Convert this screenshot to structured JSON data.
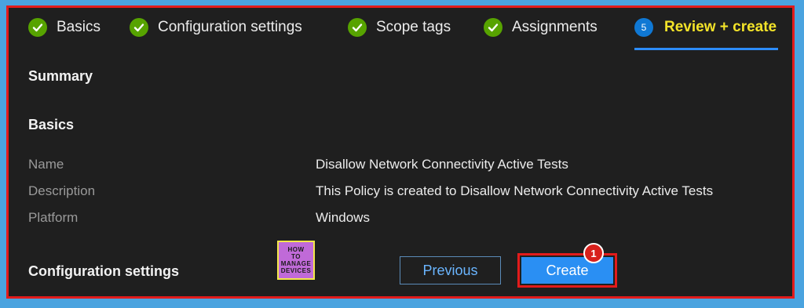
{
  "wizard": {
    "steps": [
      {
        "label": "Basics",
        "status": "complete"
      },
      {
        "label": "Configuration settings",
        "status": "complete"
      },
      {
        "label": "Scope tags",
        "status": "complete"
      },
      {
        "label": "Assignments",
        "status": "complete"
      },
      {
        "label": "Review + create",
        "status": "active",
        "number": "5"
      }
    ]
  },
  "summary": {
    "title": "Summary",
    "basics_title": "Basics",
    "fields": [
      {
        "key": "Name",
        "value": "Disallow Network Connectivity Active Tests"
      },
      {
        "key": "Description",
        "value": "This Policy is created to Disallow Network Connectivity Active Tests"
      },
      {
        "key": "Platform",
        "value": "Windows"
      }
    ],
    "config_title": "Configuration settings"
  },
  "logo": {
    "line1": "HOW",
    "line2": "TO",
    "line3": "MANAGE",
    "line4": "DEVICES"
  },
  "buttons": {
    "previous": "Previous",
    "create": "Create"
  },
  "annotation": {
    "badge": "1"
  },
  "colors": {
    "accent": "#2a8ff3",
    "highlight_border": "#e21b1b",
    "step_check": "#57a300",
    "active_step_text": "#f3e329"
  }
}
